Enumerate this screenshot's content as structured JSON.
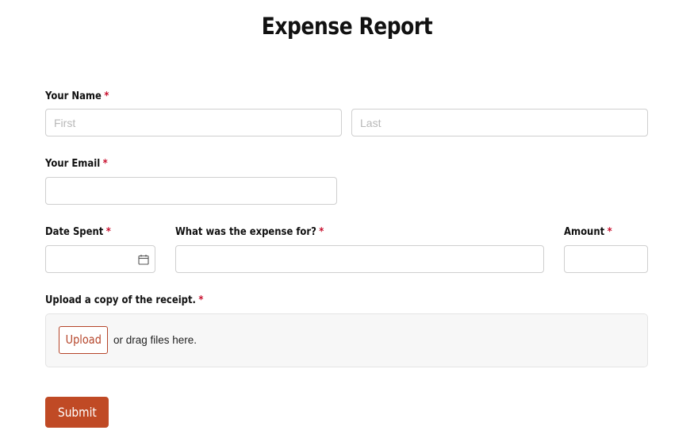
{
  "form": {
    "title": "Expense Report",
    "required_marker": "*",
    "name": {
      "label": "Your Name",
      "first_placeholder": "First",
      "last_placeholder": "Last",
      "first_value": "",
      "last_value": ""
    },
    "email": {
      "label": "Your Email",
      "value": ""
    },
    "date": {
      "label": "Date Spent",
      "value": "",
      "icon": "calendar-icon"
    },
    "expense_for": {
      "label": "What was the expense for?",
      "value": ""
    },
    "amount": {
      "label": "Amount",
      "value": ""
    },
    "receipt": {
      "label": "Upload a copy of the receipt.",
      "upload_label": "Upload",
      "drag_text": "or drag files here."
    },
    "submit_label": "Submit"
  },
  "colors": {
    "accent": "#c04a25",
    "required": "#c8102e",
    "border": "#cfcfcf",
    "dropzone_bg": "#f7f7f7"
  }
}
